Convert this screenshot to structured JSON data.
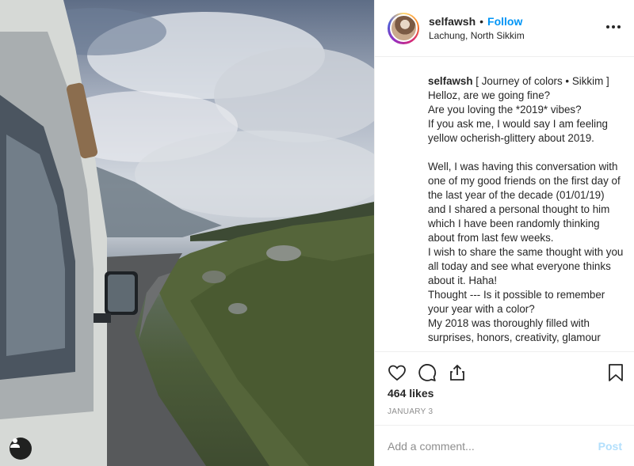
{
  "post": {
    "username": "selfawsh",
    "dot": "•",
    "follow_label": "Follow",
    "location": "Lachung, North Sikkim",
    "more_icon": "more-icon",
    "caption_username": "selfawsh",
    "caption_text": " [ Journey of colors • Sikkim ]\nHelloz, are we going fine?\nAre you loving the *2019* vibes?\nIf you ask me, I would say I am feeling yellow ocherish-glittery about 2019.\n\nWell, I was having this conversation with one of my good friends on the first day of the last year of the decade (01/01/19) and I shared a personal thought to him which I have been randomly thinking about from last few weeks.\nI wish to share the same thought with you all today and see what everyone thinks about it. Haha!\nThought --- Is it possible to remember your year with a color?\nMy 2018 was thoroughly filled with surprises, honors, creativity, glamour",
    "likes": "464 likes",
    "date": "JANUARY 3"
  },
  "actions": {
    "icons": [
      "heart-icon",
      "comment-icon",
      "share-icon",
      "bookmark-icon"
    ]
  },
  "comment": {
    "placeholder": "Add a comment...",
    "post_label": "Post"
  },
  "colors": {
    "follow": "#0095f6",
    "post_disabled": "#b2dffc",
    "border": "#efefef"
  }
}
